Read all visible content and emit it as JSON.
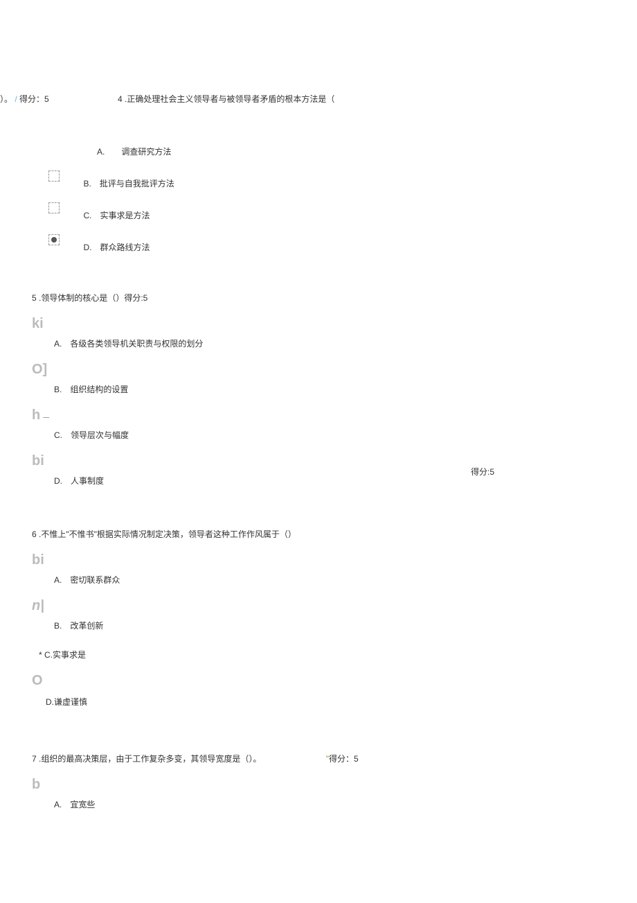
{
  "q4": {
    "score_prefix": "）。",
    "score_slash": "/",
    "score_text": "得分：5",
    "number": "4",
    "text": ".正确处理社会主义领导者与被领导者矛盾的根本方法是（",
    "options": {
      "a": "A.　　调查研究方法",
      "b": "B.　批评与自我批评方法",
      "c": "C.　实事求是方法",
      "d": "D.　群众路线方法"
    }
  },
  "q5": {
    "text": "5 .领导体制的核心是（）得分:5",
    "artifacts": {
      "a": "ki",
      "b": "O]",
      "c": "h",
      "d": "bi"
    },
    "options": {
      "a": "A.　各级各类领导机关职责与权限的划分",
      "b": "B.　组织结构的设置",
      "c": "C.　领导层次与幅度",
      "d": "D.　人事制度"
    }
  },
  "q6": {
    "score": "得分:5",
    "text": "6 .不惟上\"不惟书\"根据实际情况制定决策，领导者这种工作作风属于（）",
    "artifacts": {
      "a": "bi",
      "b": "n|",
      "d": "O"
    },
    "options": {
      "a": "A.　密切联系群众",
      "b": "B.　改革创新",
      "c": "* C.实事求是",
      "d": "D.谦虚谨慎"
    }
  },
  "q7": {
    "text": "7 .组织的最高决策层，由于工作复杂多变，其领导宽度是（）。",
    "score_quote": "\"",
    "score": "得分：5",
    "artifacts": {
      "a": "b"
    },
    "options": {
      "a": "A.　宜宽些"
    }
  }
}
